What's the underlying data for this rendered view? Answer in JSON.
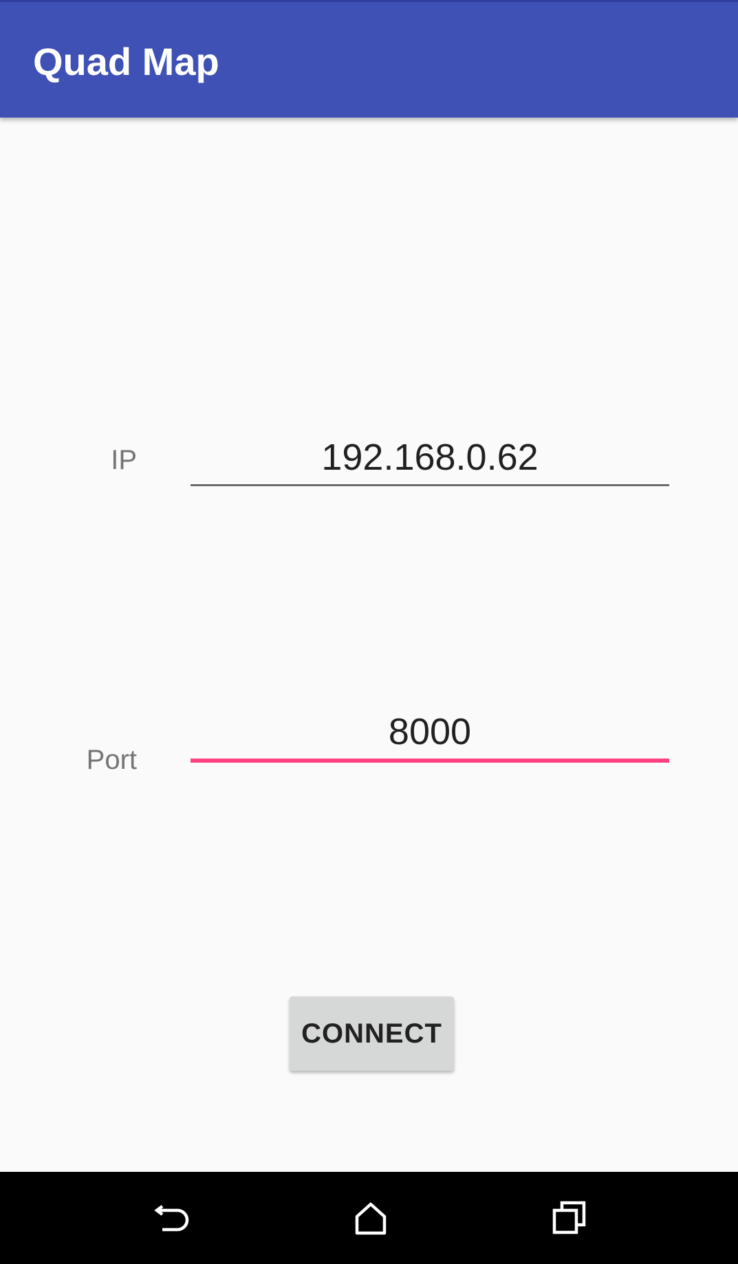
{
  "app_bar": {
    "title": "Quad Map",
    "background": "#3f51b5"
  },
  "form": {
    "ip": {
      "label": "IP",
      "value": "192.168.0.62"
    },
    "port": {
      "label": "Port",
      "value": "8000",
      "focused": true
    },
    "accent_color": "#ff4081"
  },
  "connect_button": {
    "label": "CONNECT"
  },
  "nav_bar": {
    "back_icon": "back-icon",
    "home_icon": "home-icon",
    "recents_icon": "recents-icon"
  }
}
